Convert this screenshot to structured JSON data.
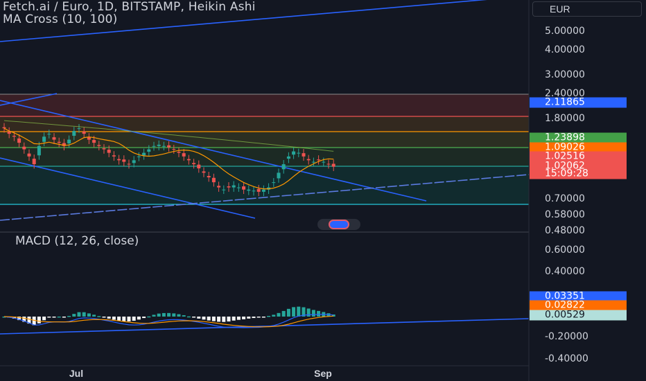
{
  "header": {
    "title": "Fetch.ai / Euro, 1D, BITSTAMP, Heikin Ashi",
    "indicator": "MA Cross (10, 100)"
  },
  "currency_selector": "EUR",
  "price_axis": {
    "scale": "log",
    "ticks": [
      "5.00000",
      "4.00000",
      "3.00000",
      "2.40000",
      "1.80000",
      "0.70000",
      "0.58000",
      "0.48000"
    ],
    "badges": [
      {
        "label": "2.11865",
        "color": "#2962ff"
      },
      {
        "label": "1.23898",
        "color": "#43a047"
      },
      {
        "label": "1.09026",
        "color": "#ff6d00"
      },
      {
        "label": "1.02516",
        "color": "#ef5350"
      },
      {
        "label": "1.02062",
        "color": "#ef5350"
      },
      {
        "label": "15:09:28",
        "color": "#ef5350"
      }
    ]
  },
  "macd": {
    "label": "MACD (12, 26, close)",
    "ticks": [
      "0.60000",
      "0.40000",
      "-0.20000",
      "-0.40000"
    ],
    "badges": [
      {
        "label": "0.03351",
        "color": "#2962ff"
      },
      {
        "label": "0.02822",
        "color": "#ff6d00"
      },
      {
        "label": "0.00529",
        "color": "#b2dfdb",
        "text": "#131722"
      }
    ]
  },
  "time_axis": {
    "ticks": [
      "Jul",
      "Sep"
    ]
  },
  "colors": {
    "bull": "#26a69a",
    "bear": "#ef5350",
    "ma_fast": "#ff9800",
    "ma_slow": "#8bc34a",
    "trend": "#2962ff"
  },
  "chart_data": {
    "type": "candlestick",
    "title": "Fetch.ai / Euro, 1D, BITSTAMP, Heikin Ashi",
    "ohlc_close_approx": [
      1.6,
      1.5,
      1.45,
      1.35,
      1.25,
      1.15,
      1.05,
      1.3,
      1.45,
      1.5,
      1.4,
      1.35,
      1.3,
      1.4,
      1.55,
      1.6,
      1.5,
      1.4,
      1.35,
      1.3,
      1.25,
      1.2,
      1.15,
      1.1,
      1.08,
      1.05,
      1.1,
      1.15,
      1.2,
      1.25,
      1.3,
      1.32,
      1.3,
      1.28,
      1.25,
      1.2,
      1.15,
      1.1,
      1.05,
      1.0,
      0.95,
      0.9,
      0.85,
      0.8,
      0.78,
      0.8,
      0.82,
      0.8,
      0.78,
      0.78,
      0.77,
      0.76,
      0.78,
      0.8,
      0.85,
      0.95,
      1.05,
      1.15,
      1.22,
      1.2,
      1.15,
      1.1,
      1.08,
      1.1,
      1.08,
      1.05,
      1.02
    ],
    "levels": [
      2.11865,
      1.23898,
      1.09026,
      1.02516,
      1.02062
    ],
    "last_price": 1.02516,
    "countdown": "15:09:28",
    "macd_values": {
      "macd": 0.03351,
      "signal": 0.02822,
      "histogram": 0.00529
    }
  }
}
